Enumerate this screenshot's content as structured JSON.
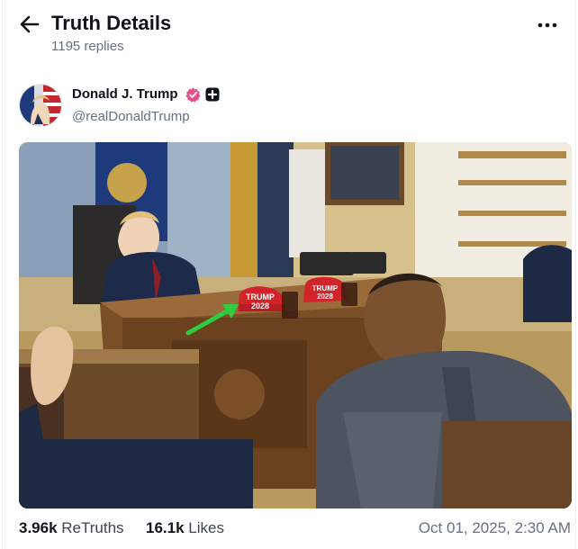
{
  "header": {
    "title": "Truth Details",
    "replies": "1195 replies"
  },
  "post": {
    "author_name": "Donald J. Trump",
    "handle": "@realDonaldTrump",
    "image_labels": {
      "hat_line1": "TRUMP",
      "hat_line2": "2028",
      "hat2_line1": "TRUMP",
      "hat2_line2": "2028"
    },
    "stats": {
      "retruths_count": "3.96k",
      "retruths_label": "ReTruths",
      "likes_count": "16.1k",
      "likes_label": "Likes"
    },
    "timestamp": "Oct 01, 2025, 2:30 AM"
  },
  "icons": {
    "back": "arrow-left-icon",
    "more": "more-horizontal-icon",
    "verified": "verified-badge-icon",
    "plus": "plus-badge-icon"
  },
  "colors": {
    "verified": "#e74c8b",
    "hat_red": "#d2232a",
    "arrow_green": "#2ecc40"
  }
}
